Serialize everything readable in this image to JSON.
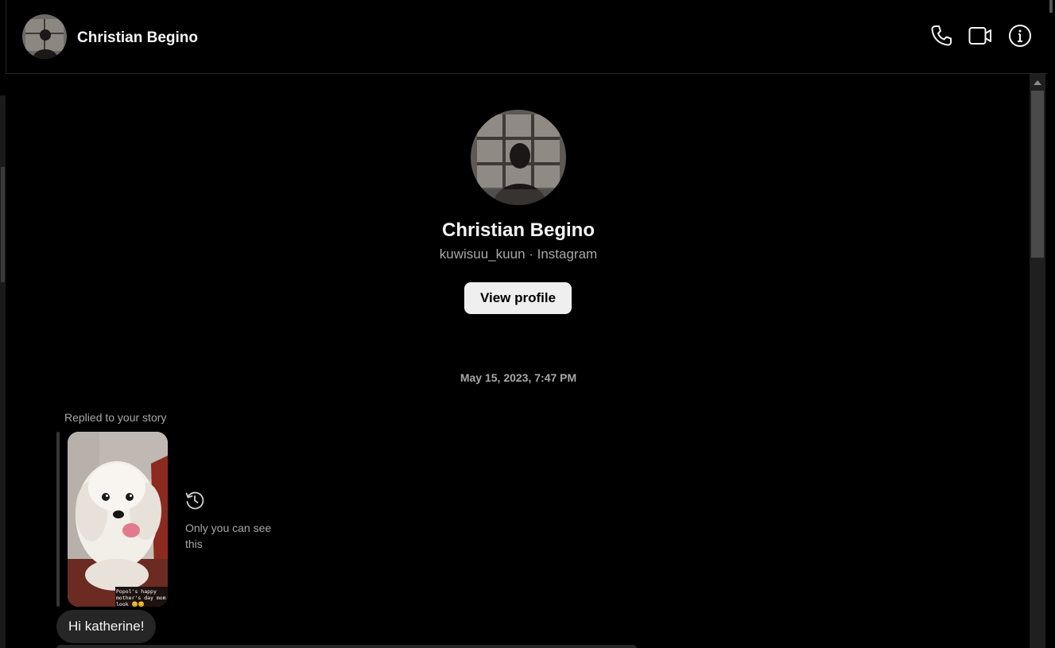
{
  "header": {
    "contact_name": "Christian Begino",
    "icons": [
      "phone-icon",
      "video-camera-icon",
      "info-icon"
    ]
  },
  "profile": {
    "name": "Christian Begino",
    "subtitle": "kuwisuu_kuun · Instagram",
    "view_profile_label": "View profile"
  },
  "thread": {
    "timestamp": "May 15, 2023, 7:47 PM",
    "story_reply": {
      "label": "Replied to your story",
      "story_caption": "Popol's happy mother's day mom look 😊😊",
      "visibility_note": "Only you can see this"
    },
    "messages": [
      {
        "text": "Hi katherine!"
      }
    ]
  },
  "colors": {
    "background": "#000000",
    "bubble": "#262626",
    "secondary_text": "#a8a8a8",
    "button_bg": "#efefef"
  }
}
